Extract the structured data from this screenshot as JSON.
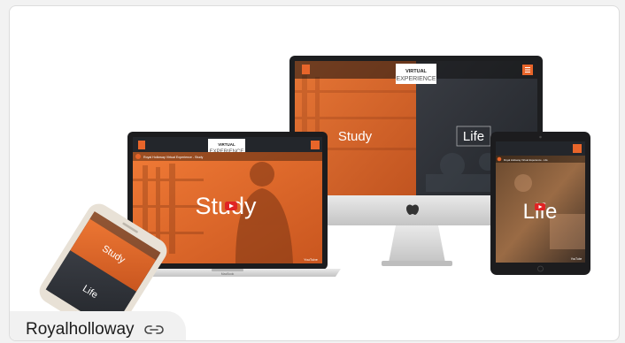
{
  "project": {
    "title": "Royalholloway",
    "link_icon": "link-icon"
  },
  "mockup": {
    "imac": {
      "logo_line1": "VIRTUAL",
      "logo_line2": "EXPERIENCE",
      "left_label": "Study",
      "right_label": "Life"
    },
    "laptop": {
      "logo_line1": "VIRTUAL",
      "logo_line2": "EXPERIENCE",
      "video_title": "Royal Holloway Virtual Experience - Study",
      "overlay_label": "Study",
      "badge": "YouTube",
      "base_label": "MacBook"
    },
    "tablet": {
      "video_title": "Royal Holloway Virtual Experience - Life",
      "overlay_label": "Life",
      "badge": "YouTube"
    },
    "phone": {
      "top_label": "Study",
      "bottom_label": "Life"
    }
  },
  "colors": {
    "accent": "#e8652a",
    "dark": "#2a2d33"
  }
}
